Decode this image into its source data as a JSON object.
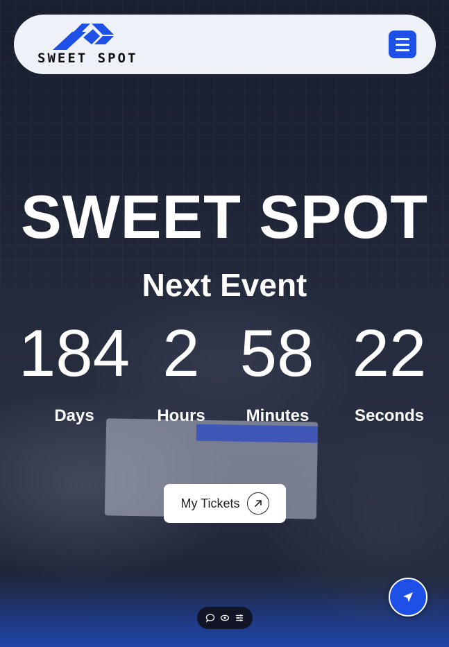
{
  "brand": {
    "name": "SWEET SPOT",
    "accent": "#1e4fe6"
  },
  "hero": {
    "title": "SWEET SPOT",
    "subtitle": "Next Event"
  },
  "countdown": [
    {
      "value": "184",
      "label": "Days"
    },
    {
      "value": "2",
      "label": "Hours"
    },
    {
      "value": "58",
      "label": "Minutes"
    },
    {
      "value": "22",
      "label": "Seconds"
    }
  ],
  "cta": {
    "label": "My Tickets",
    "icon": "arrow-up-right-icon"
  },
  "icons": {
    "menu": "hamburger-menu-icon",
    "fab": "cursor-pointer-icon",
    "toolbar": [
      "chat-bubble-icon",
      "eye-icon",
      "sliders-icon"
    ]
  }
}
